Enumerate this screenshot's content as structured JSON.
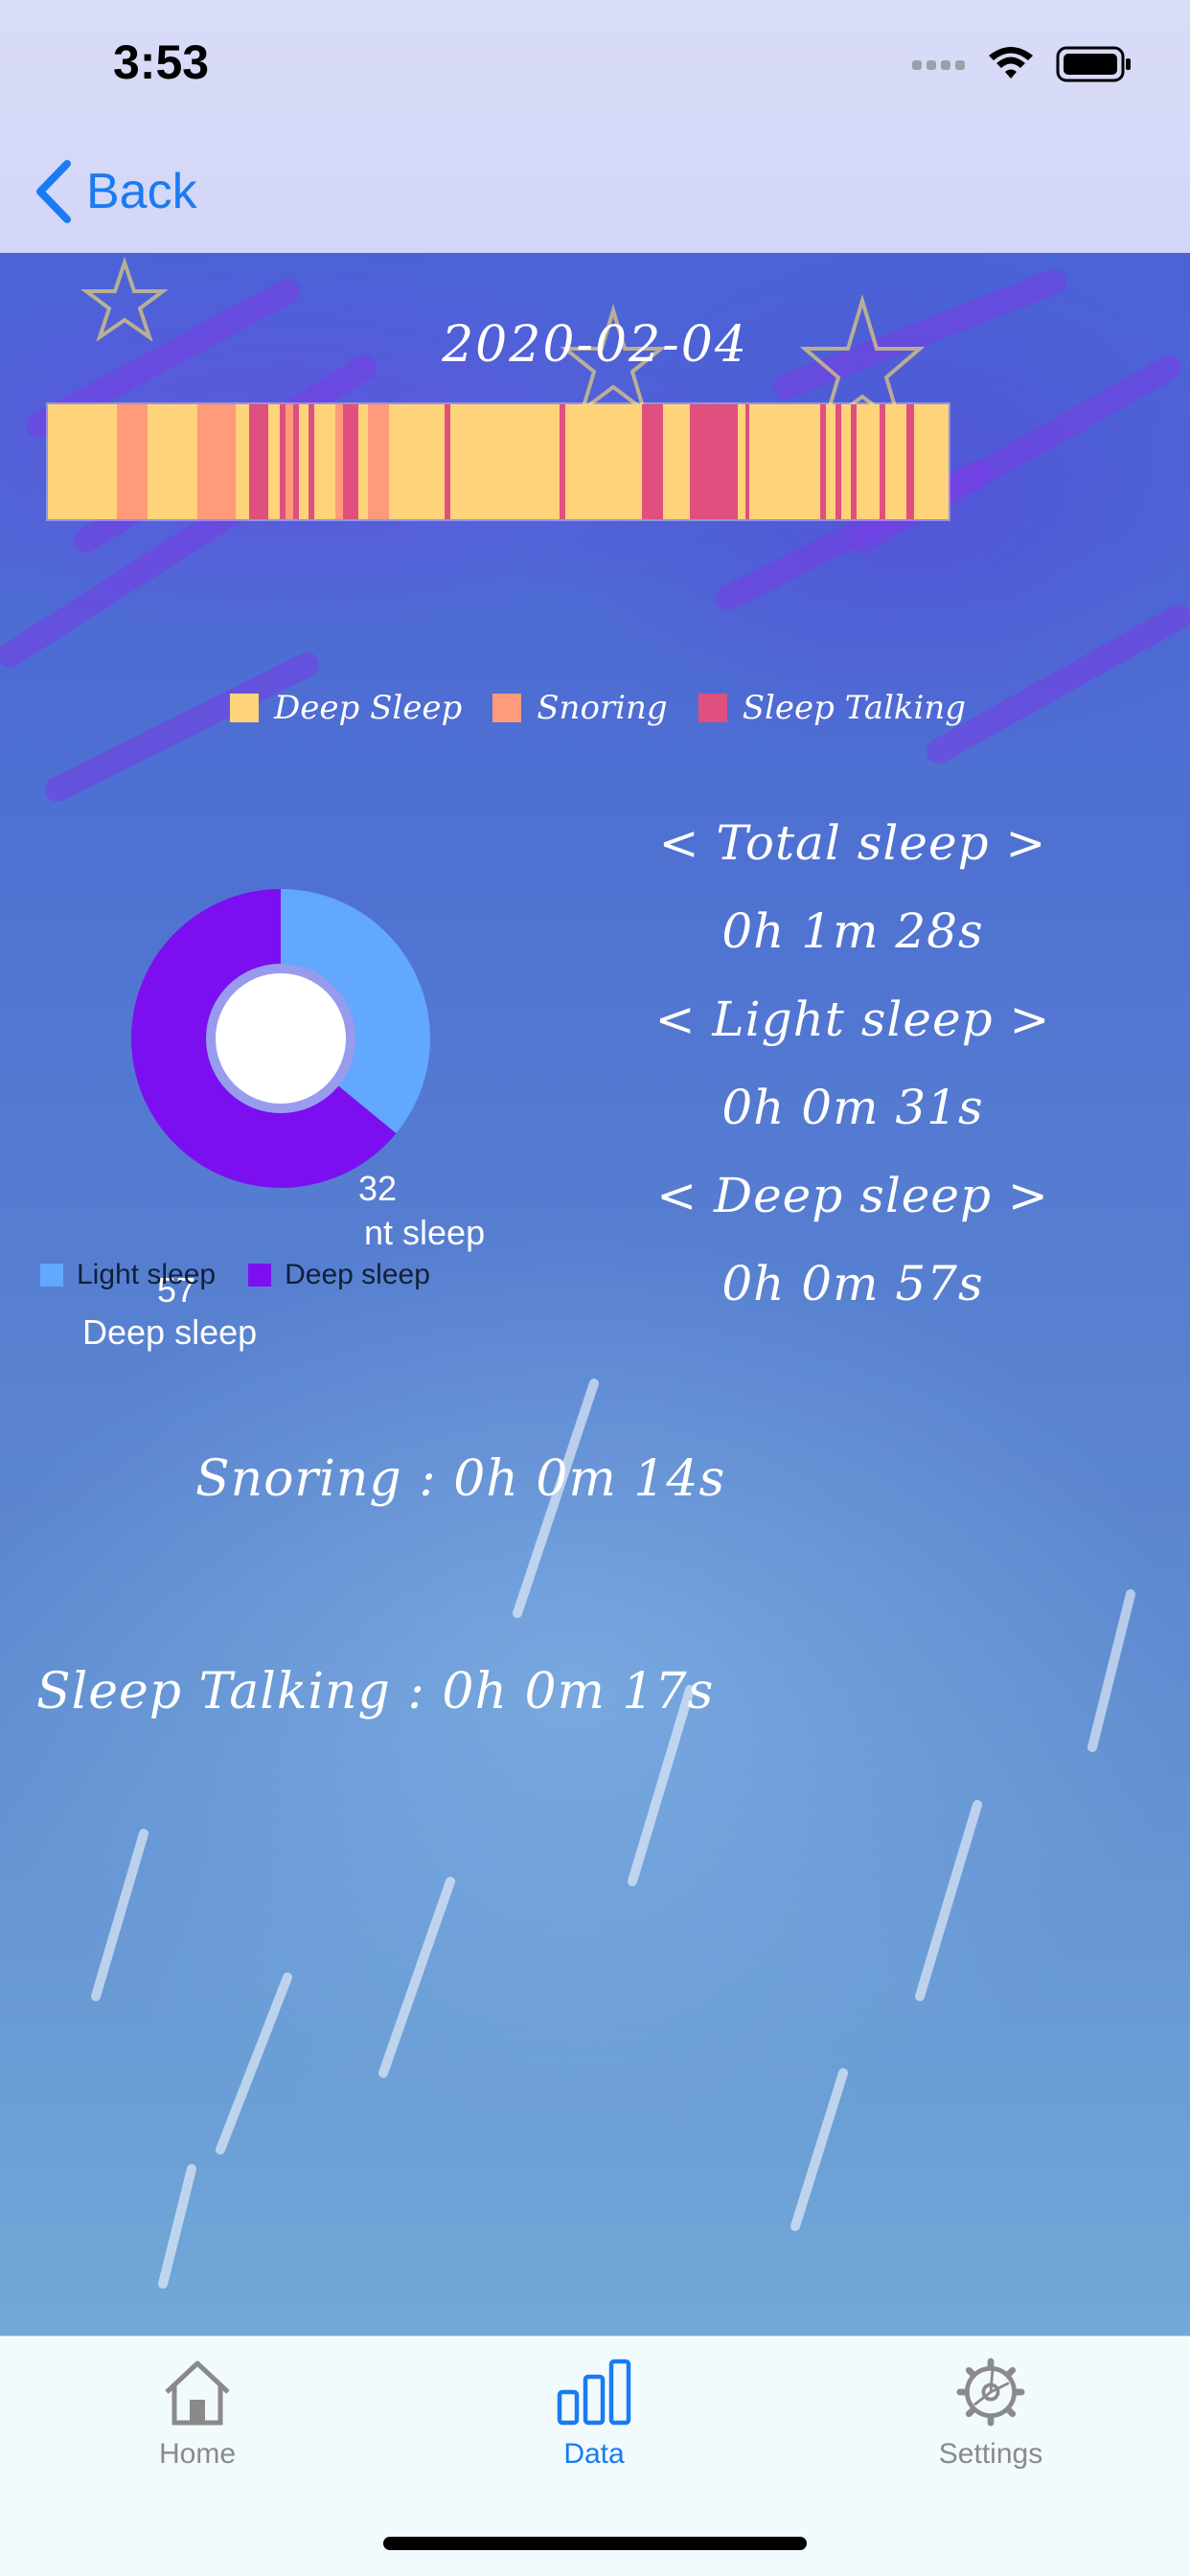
{
  "status_bar": {
    "time": "3:53"
  },
  "nav": {
    "back_label": "Back"
  },
  "report": {
    "date": "2020-02-04",
    "colors": {
      "deep_sleep": "#ffd37a",
      "snoring": "#ff9a7a",
      "sleep_talking": "#e0507e"
    },
    "legend": [
      "Deep Sleep",
      "Snoring",
      "Sleep Talking"
    ]
  },
  "chart_data": {
    "type": "pie",
    "style": "donut",
    "slices": [
      {
        "name": "Light sleep",
        "value": 32,
        "color": "#62a8ff"
      },
      {
        "name": "Deep sleep",
        "value": 57,
        "color": "#7b0ff0"
      }
    ],
    "legend": [
      "Light sleep",
      "Deep sleep"
    ],
    "legend_placement": "bottom-left"
  },
  "pie_labels": {
    "light_value": "32",
    "light_text": "nt sleep",
    "deep_value": "57",
    "deep_text": "Deep sleep"
  },
  "stats": {
    "total_header": "< Total sleep >",
    "total_value": "0h 1m 28s",
    "light_header": "< Light sleep >",
    "light_value": "0h 0m 31s",
    "deep_header": "< Deep sleep >",
    "deep_value": "0h 0m 57s"
  },
  "snoring_text": "Snoring : 0h 0m 14s",
  "talking_text": "Sleep Talking : 0h 0m 17s",
  "tabs": [
    {
      "label": "Home",
      "icon": "house-icon",
      "active": false,
      "color": "#8a8a8a"
    },
    {
      "label": "Data",
      "icon": "bar-chart-icon",
      "active": true,
      "color": "#1a7bf2"
    },
    {
      "label": "Settings",
      "icon": "gear-icon",
      "active": false,
      "color": "#8a8a8a"
    }
  ]
}
